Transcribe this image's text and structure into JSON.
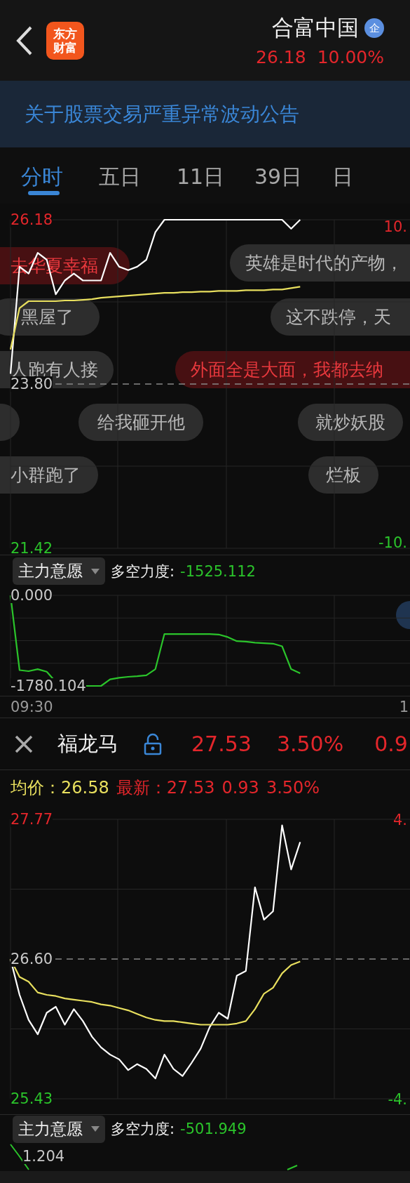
{
  "header": {
    "logo": [
      "东方",
      "财富"
    ],
    "title": "合富中国",
    "badge": "企",
    "price": "26.18",
    "change_pct": "10.00%"
  },
  "notice": "关于股票交易严重异常波动公告",
  "tabs": [
    {
      "label": "分时",
      "selected": true
    },
    {
      "label": "五日",
      "selected": false
    },
    {
      "label": "11日",
      "selected": false
    },
    {
      "label": "39日",
      "selected": false
    },
    {
      "label": "日",
      "selected": false
    }
  ],
  "price_chart": {
    "axis_labels": [
      "26.18",
      "23.80",
      "21.42"
    ],
    "right_labels": [
      "10.",
      "-10."
    ],
    "comments": [
      {
        "text": "去华夏幸福",
        "highlight": true
      },
      {
        "text": "英雄是时代的产物，",
        "highlight": false
      },
      {
        "text": "黑屋了",
        "highlight": false
      },
      {
        "text": "这不跌停，天",
        "highlight": false
      },
      {
        "text": "人跑有人接",
        "highlight": false
      },
      {
        "text": "外面全是大面，我都去纳",
        "highlight": true
      },
      {
        "text": "给我砸开他",
        "highlight": false
      },
      {
        "text": "就炒妖股",
        "highlight": false
      },
      {
        "text": "小群跑了",
        "highlight": false
      },
      {
        "text": "烂板",
        "highlight": false
      }
    ]
  },
  "indicator": {
    "name": "主力意愿",
    "label": "多空力度:",
    "value": "-1525.112",
    "axis_labels": [
      "0.000",
      "-1780.104"
    ]
  },
  "time_axis": [
    "09:30",
    "1"
  ],
  "compare": {
    "name": "福龙马",
    "locked": false,
    "price": "27.53",
    "change_pct": "3.50%",
    "change": "0.9"
  },
  "compare_info": {
    "avg_label": "均价：",
    "avg": "26.58",
    "latest_label": "最新：",
    "latest": "27.53",
    "change": "0.93",
    "change_pct": "3.50%"
  },
  "compare_chart": {
    "axis_labels": [
      "27.77",
      "26.60",
      "25.43"
    ],
    "right_labels": [
      "4.",
      "-4."
    ]
  },
  "compare_indicator": {
    "name": "主力意愿",
    "label": "多空力度:",
    "value": "-501.949",
    "scale_label": "1.204"
  }
}
